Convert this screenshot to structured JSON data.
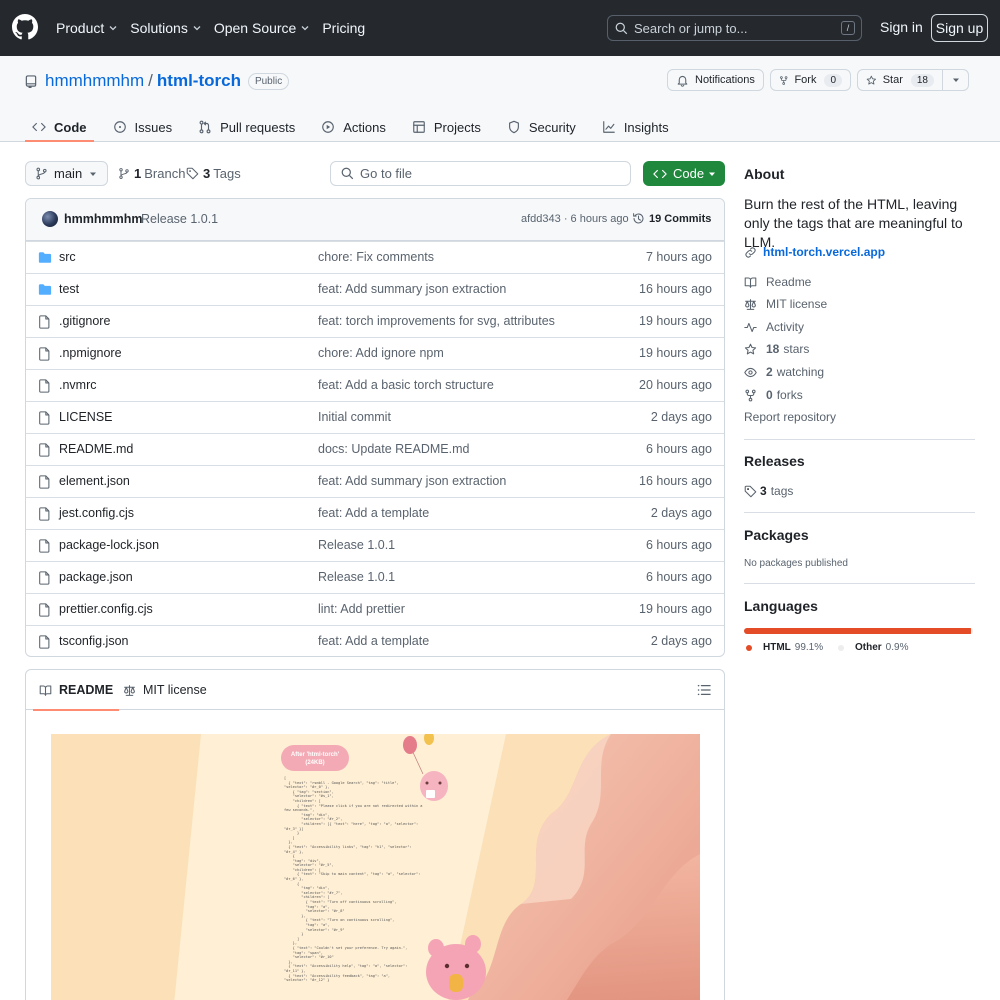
{
  "header": {
    "nav": [
      "Product",
      "Solutions",
      "Open Source",
      "Pricing"
    ],
    "search_placeholder": "Search or jump to...",
    "search_key": "/",
    "sign_in": "Sign in",
    "sign_up": "Sign up"
  },
  "repo": {
    "owner": "hmmhmmhm",
    "slash": "/",
    "name": "html-torch",
    "visibility": "Public",
    "notifications_label": "Notifications",
    "fork_label": "Fork",
    "fork_count": "0",
    "star_label": "Star",
    "star_count": "18"
  },
  "tabs": [
    {
      "label": "Code",
      "icon": "code-icon",
      "active": true
    },
    {
      "label": "Issues",
      "icon": "issue-icon"
    },
    {
      "label": "Pull requests",
      "icon": "pull-request-icon"
    },
    {
      "label": "Actions",
      "icon": "play-icon"
    },
    {
      "label": "Projects",
      "icon": "table-icon"
    },
    {
      "label": "Security",
      "icon": "shield-icon"
    },
    {
      "label": "Insights",
      "icon": "graph-icon"
    }
  ],
  "toolbar": {
    "branch": "main",
    "branch_count": "1",
    "branch_label": "Branch",
    "tag_count": "3",
    "tag_label": "Tags",
    "goto_placeholder": "Go to file",
    "code_button": "Code"
  },
  "latest_commit": {
    "author": "hmmhmmhm",
    "message": "Release 1.0.1",
    "hash_time": "afdd343 · 6 hours ago",
    "commits_label": "19 Commits"
  },
  "files": [
    {
      "name": "src",
      "type": "dir",
      "message": "chore: Fix comments",
      "time": "7 hours ago"
    },
    {
      "name": "test",
      "type": "dir",
      "message": "feat: Add summary json extraction",
      "time": "16 hours ago"
    },
    {
      "name": ".gitignore",
      "type": "file",
      "message": "feat: torch improvements for svg, attributes",
      "time": "19 hours ago"
    },
    {
      "name": ".npmignore",
      "type": "file",
      "message": "chore: Add ignore npm",
      "time": "19 hours ago"
    },
    {
      "name": ".nvmrc",
      "type": "file",
      "message": "feat: Add a basic torch structure",
      "time": "20 hours ago"
    },
    {
      "name": "LICENSE",
      "type": "file",
      "message": "Initial commit",
      "time": "2 days ago"
    },
    {
      "name": "README.md",
      "type": "file",
      "message": "docs: Update README.md",
      "time": "6 hours ago"
    },
    {
      "name": "element.json",
      "type": "file",
      "message": "feat: Add summary json extraction",
      "time": "16 hours ago"
    },
    {
      "name": "jest.config.cjs",
      "type": "file",
      "message": "feat: Add a template",
      "time": "2 days ago"
    },
    {
      "name": "package-lock.json",
      "type": "file",
      "message": "Release 1.0.1",
      "time": "6 hours ago"
    },
    {
      "name": "package.json",
      "type": "file",
      "message": "Release 1.0.1",
      "time": "6 hours ago"
    },
    {
      "name": "prettier.config.cjs",
      "type": "file",
      "message": "lint: Add prettier",
      "time": "19 hours ago"
    },
    {
      "name": "tsconfig.json",
      "type": "file",
      "message": "feat: Add a template",
      "time": "2 days ago"
    }
  ],
  "readme": {
    "tab_readme": "README",
    "tab_license": "MIT license",
    "hero_pill_line1": "After 'html-torch'",
    "hero_pill_line2": "(24KB)",
    "hero_code": "[\n  { \"text\": \"rsmbll - Google Search\", \"tag\": \"title\",\n\"selector\": \"#r_0\" },\n    { \"tag\": \"section\",\n    \"selector\": \"#s_1\",\n    \"children\": [\n      { \"text\": \"Please click if you are not redirected within a\nfew seconds.\",\n        \"tag\": \"div\",\n        \"selector\": \"#r_2\",\n        \"children\": [{ \"text\": \"here\", \"tag\": \"a\", \"selector\":\n\"#r_3\" }]\n      }\n    ]\n  },\n  { \"text\": \"Accessibility links\", \"tag\": \"h1\", \"selector\":\n\"#r_4\" },\n    {\n    \"tag\": \"div\",\n    \"selector\": \"#r_5\",\n    \"children\": [\n      { \"text\": \"Skip to main content\", \"tag\": \"a\", \"selector\":\n\"#r_6\" },\n      {\n        \"tag\": \"div\",\n        \"selector\": \"#r_7\",\n        \"children\": [\n          { \"text\": \"Turn off continuous scrolling\",\n          \"tag\": \"a\",\n          \"selector\": \"#r_8\"\n        },\n          { \"text\": \"Turn on continuous scrolling\",\n          \"tag\": \"a\",\n          \"selector\": \"#r_9\"\n        }\n      ]\n    },\n    { \"text\": \"Couldn't set your preference. Try again.\",\n    \"tag\": \"span\",\n    \"selector\": \"#r_10\"\n  },\n  { \"text\": \"Accessibility help\", \"tag\": \"a\", \"selector\":\n\"#r_11\" },\n  { \"text\": \"Accessibility feedback\", \"tag\": \"a\",\n\"selector\": \"#r_12\" }"
  },
  "about": {
    "title": "About",
    "description": "Burn the rest of the HTML, leaving only the tags that are meaningful to LLM.",
    "website": "html-torch.vercel.app",
    "readme": "Readme",
    "license": "MIT license",
    "activity": "Activity",
    "stars_count": "18",
    "stars_label": "stars",
    "watching_count": "2",
    "watching_label": "watching",
    "forks_count": "0",
    "forks_label": "forks",
    "report": "Report repository"
  },
  "releases": {
    "title": "Releases",
    "tag_count": "3",
    "tag_label": "tags"
  },
  "packages": {
    "title": "Packages",
    "note": "No packages published"
  },
  "languages": {
    "title": "Languages",
    "items": [
      {
        "name": "HTML",
        "percent": "99.1%",
        "value": 99.1,
        "color": "#e34c26"
      },
      {
        "name": "Other",
        "percent": "0.9%",
        "value": 0.9,
        "color": "#ededed"
      }
    ]
  },
  "colors": {
    "header_bg": "#25292e",
    "link": "#0969da",
    "code_button": "#1f883d",
    "tab_underline": "#fd8c73",
    "folder": "#54aeff"
  }
}
